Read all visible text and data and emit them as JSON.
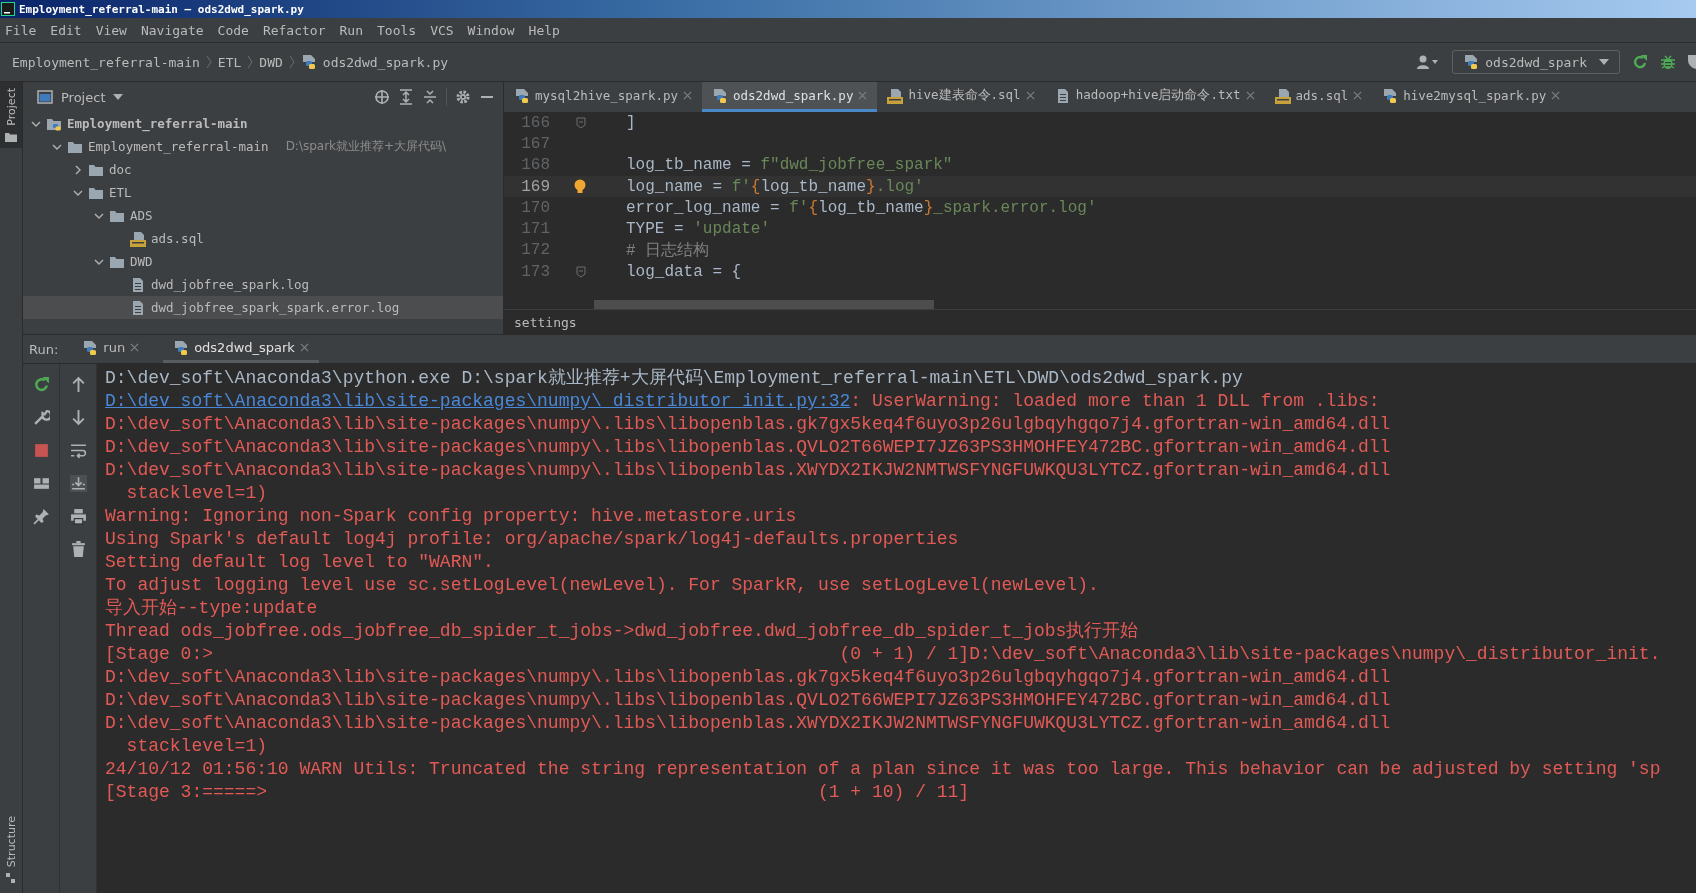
{
  "window": {
    "title": "Employment_referral-main – ods2dwd_spark.py"
  },
  "menu": [
    "File",
    "Edit",
    "View",
    "Navigate",
    "Code",
    "Refactor",
    "Run",
    "Tools",
    "VCS",
    "Window",
    "Help"
  ],
  "breadcrumb": [
    "Employment_referral-main",
    "ETL",
    "DWD",
    "ods2dwd_spark.py"
  ],
  "run_config": {
    "label": "ods2dwd_spark"
  },
  "side_strip": {
    "top": "Project",
    "bottom": "Structure"
  },
  "project_panel": {
    "title": "Project",
    "tree": [
      {
        "label": "Employment_referral-main",
        "kind": "project",
        "expanded": true,
        "selected": false,
        "children": [
          {
            "label": "Employment_referral-main",
            "hint": "D:\\spark就业推荐+大屏代码\\",
            "kind": "folder",
            "expanded": true,
            "selected": false,
            "children": [
              {
                "label": "doc",
                "kind": "folder",
                "expanded": false,
                "selected": false
              },
              {
                "label": "ETL",
                "kind": "folder",
                "expanded": true,
                "selected": false,
                "children": [
                  {
                    "label": "ADS",
                    "kind": "folder",
                    "expanded": true,
                    "selected": false,
                    "children": [
                      {
                        "label": "ads.sql",
                        "kind": "sql",
                        "selected": false
                      }
                    ]
                  },
                  {
                    "label": "DWD",
                    "kind": "folder",
                    "expanded": true,
                    "selected": false,
                    "children": [
                      {
                        "label": "dwd_jobfree_spark.log",
                        "kind": "file",
                        "selected": false
                      },
                      {
                        "label": "dwd_jobfree_spark_spark.error.log",
                        "kind": "file",
                        "selected": true
                      }
                    ]
                  }
                ]
              }
            ]
          }
        ]
      }
    ]
  },
  "editor_tabs": [
    {
      "label": "mysql2hive_spark.py",
      "kind": "python",
      "selected": false
    },
    {
      "label": "ods2dwd_spark.py",
      "kind": "python",
      "selected": true
    },
    {
      "label": "hive建表命令.sql",
      "kind": "sql",
      "selected": false
    },
    {
      "label": "hadoop+hive启动命令.txt",
      "kind": "file",
      "selected": false
    },
    {
      "label": "ads.sql",
      "kind": "sql",
      "selected": false
    },
    {
      "label": "hive2mysql_spark.py",
      "kind": "python",
      "selected": false
    }
  ],
  "code_lines": [
    {
      "number": "166",
      "current": false,
      "kind": "fold",
      "segments": [
        {
          "t": "]",
          "kind": "plain"
        }
      ]
    },
    {
      "number": "167",
      "current": false,
      "kind": "plain"
    },
    {
      "number": "168",
      "current": false,
      "kind": "plain",
      "segments": [
        {
          "t": "log_tb_name = ",
          "kind": "plain"
        },
        {
          "t": "f\"dwd_jobfree_spark\"",
          "kind": "string"
        }
      ]
    },
    {
      "number": "169",
      "current": true,
      "kind": "bulb",
      "segments": [
        {
          "t": "log_name = ",
          "kind": "plain"
        },
        {
          "t": "f'",
          "kind": "string"
        },
        {
          "t": "{",
          "kind": "brace"
        },
        {
          "t": "log_tb_name",
          "kind": "plain"
        },
        {
          "t": "}",
          "kind": "brace"
        },
        {
          "t": ".log'",
          "kind": "string"
        }
      ]
    },
    {
      "number": "170",
      "current": false,
      "kind": "plain",
      "segments": [
        {
          "t": "error_log_name = ",
          "kind": "plain"
        },
        {
          "t": "f'",
          "kind": "string"
        },
        {
          "t": "{",
          "kind": "brace"
        },
        {
          "t": "log_tb_name",
          "kind": "plain"
        },
        {
          "t": "}",
          "kind": "brace"
        },
        {
          "t": "_spark.error.log'",
          "kind": "string"
        }
      ]
    },
    {
      "number": "171",
      "current": false,
      "kind": "plain",
      "segments": [
        {
          "t": "TYPE = ",
          "kind": "plain"
        },
        {
          "t": "'update'",
          "kind": "string"
        }
      ]
    },
    {
      "number": "172",
      "current": false,
      "kind": "plain",
      "segments": [
        {
          "t": "# 日志结构",
          "kind": "comment"
        }
      ]
    },
    {
      "number": "173",
      "current": false,
      "kind": "fold",
      "segments": [
        {
          "t": "log_data = {",
          "kind": "plain"
        }
      ]
    }
  ],
  "editor_breadcrumb": "settings",
  "run_panel": {
    "label": "Run:",
    "tabs": [
      {
        "label": "run",
        "selected": false
      },
      {
        "label": "ods2dwd_spark",
        "selected": true
      }
    ]
  },
  "console_lines": [
    [
      {
        "t": "D:\\dev_soft\\Anaconda3\\python.exe D:\\spark就业推荐+大屏代码\\Employment_referral-main\\ETL\\DWD\\ods2dwd_spark.py",
        "kind": "plain"
      }
    ],
    [
      {
        "t": "D:\\dev_soft\\Anaconda3\\lib\\site-packages\\numpy\\_distributor_init.py:32",
        "kind": "link"
      },
      {
        "t": ": UserWarning: loaded more than 1 DLL from .libs:",
        "kind": "error"
      }
    ],
    [
      {
        "t": "D:\\dev_soft\\Anaconda3\\lib\\site-packages\\numpy\\.libs\\libopenblas.gk7gx5keq4f6uyo3p26ulgbqyhgqo7j4.gfortran-win_amd64.dll",
        "kind": "error"
      }
    ],
    [
      {
        "t": "D:\\dev_soft\\Anaconda3\\lib\\site-packages\\numpy\\.libs\\libopenblas.QVLO2T66WEPI7JZ63PS3HMOHFEY472BC.gfortran-win_amd64.dll",
        "kind": "error"
      }
    ],
    [
      {
        "t": "D:\\dev_soft\\Anaconda3\\lib\\site-packages\\numpy\\.libs\\libopenblas.XWYDX2IKJW2NMTWSFYNGFUWKQU3LYTCZ.gfortran-win_amd64.dll",
        "kind": "error"
      }
    ],
    [
      {
        "t": "  stacklevel=1)",
        "kind": "error"
      }
    ],
    [
      {
        "t": "Warning: Ignoring non-Spark config property: hive.metastore.uris",
        "kind": "error"
      }
    ],
    [
      {
        "t": "Using Spark's default log4j profile: org/apache/spark/log4j-defaults.properties",
        "kind": "error"
      }
    ],
    [
      {
        "t": "Setting default log level to \"WARN\".",
        "kind": "error"
      }
    ],
    [
      {
        "t": "To adjust logging level use sc.setLogLevel(newLevel). For SparkR, use setLogLevel(newLevel).",
        "kind": "error"
      }
    ],
    [
      {
        "t": "导入开始--type:update",
        "kind": "error"
      }
    ],
    [
      {
        "t": "Thread ods_jobfree.ods_jobfree_db_spider_t_jobs->dwd_jobfree.dwd_jobfree_db_spider_t_jobs执行开始",
        "kind": "error"
      }
    ],
    [
      {
        "t": "[Stage 0:>                                                          (0 + 1) / 1]D:\\dev_soft\\Anaconda3\\lib\\site-packages\\numpy\\_distributor_init.",
        "kind": "error"
      }
    ],
    [
      {
        "t": "D:\\dev_soft\\Anaconda3\\lib\\site-packages\\numpy\\.libs\\libopenblas.gk7gx5keq4f6uyo3p26ulgbqyhgqo7j4.gfortran-win_amd64.dll",
        "kind": "error"
      }
    ],
    [
      {
        "t": "D:\\dev_soft\\Anaconda3\\lib\\site-packages\\numpy\\.libs\\libopenblas.QVLO2T66WEPI7JZ63PS3HMOHFEY472BC.gfortran-win_amd64.dll",
        "kind": "error"
      }
    ],
    [
      {
        "t": "D:\\dev_soft\\Anaconda3\\lib\\site-packages\\numpy\\.libs\\libopenblas.XWYDX2IKJW2NMTWSFYNGFUWKQU3LYTCZ.gfortran-win_amd64.dll",
        "kind": "error"
      }
    ],
    [
      {
        "t": "  stacklevel=1)",
        "kind": "error"
      }
    ],
    [
      {
        "t": "24/10/12 01:56:10 WARN Utils: Truncated the string representation of a plan since it was too large. This behavior can be adjusted by setting 'sp",
        "kind": "error"
      }
    ],
    [
      {
        "t": "[Stage 3:=====>                                                   (1 + 10) / 11]",
        "kind": "error"
      }
    ]
  ]
}
